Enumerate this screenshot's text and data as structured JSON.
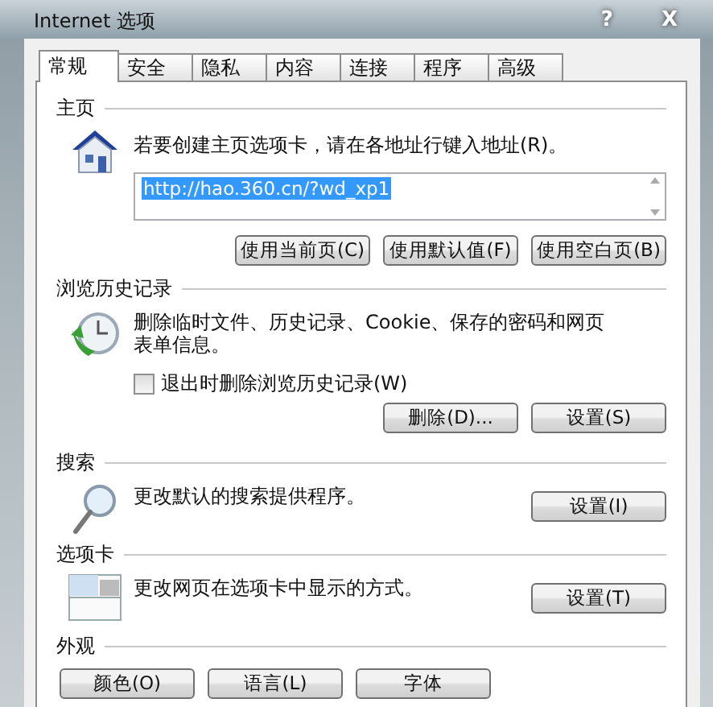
{
  "window": {
    "title": "Internet 选项",
    "help": "?",
    "close": "X"
  },
  "tabs": [
    {
      "label": "常规",
      "selected": true
    },
    {
      "label": "安全",
      "selected": false
    },
    {
      "label": "隐私",
      "selected": false
    },
    {
      "label": "内容",
      "selected": false
    },
    {
      "label": "连接",
      "selected": false
    },
    {
      "label": "程序",
      "selected": false
    },
    {
      "label": "高级",
      "selected": false
    }
  ],
  "sections": [
    {
      "kind": "homepage",
      "title": "主页",
      "text": "若要创建主页选项卡，请在各地址行键入地址(R)。",
      "value": "http://hao.360.cn/?wd_xp1",
      "buttons": [
        "使用当前页(C)",
        "使用默认值(F)",
        "使用空白页(B)"
      ]
    },
    {
      "kind": "history",
      "title": "浏览历史记录",
      "text": "删除临时文件、历史记录、Cookie、保存的密码和网页表单信息。",
      "checkbox": {
        "label": "退出时删除浏览历史记录(W)",
        "checked": false
      },
      "buttons": [
        "删除(D)...",
        "设置(S)"
      ]
    },
    {
      "kind": "search",
      "title": "搜索",
      "text": "更改默认的搜索提供程序。",
      "buttons": [
        "设置(I)"
      ]
    },
    {
      "kind": "tabs",
      "title": "选项卡",
      "text": "更改网页在选项卡中显示的方式。",
      "buttons": [
        "设置(T)"
      ]
    },
    {
      "kind": "appearance",
      "title": "外观",
      "buttons": [
        "颜色(O)",
        "语言(L)",
        "字体"
      ]
    }
  ]
}
